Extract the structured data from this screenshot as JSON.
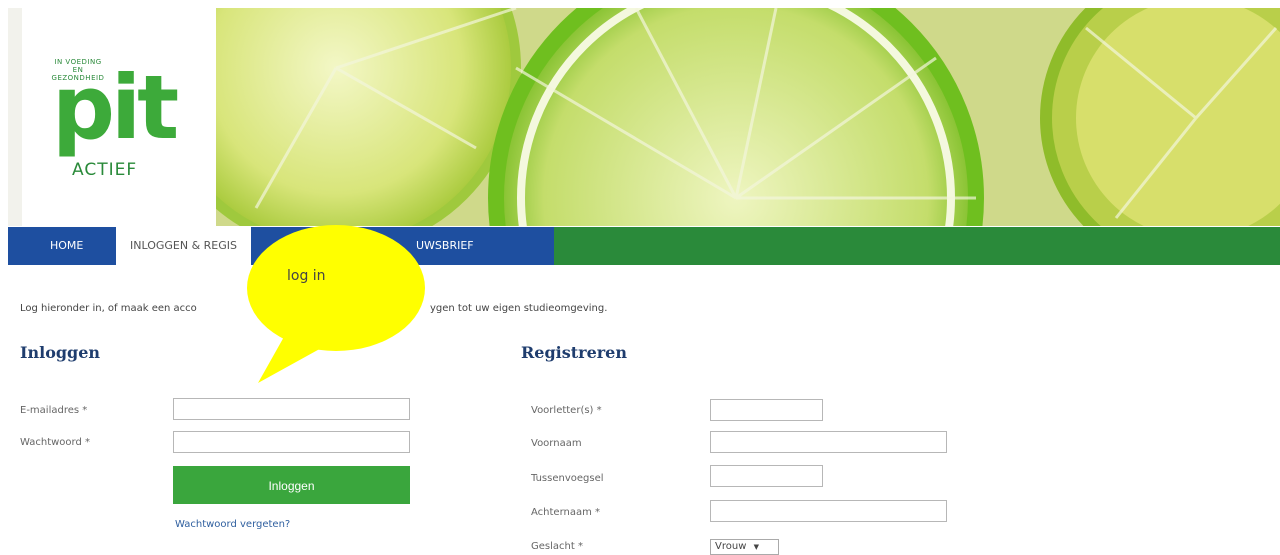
{
  "logo": {
    "tagline": "IN VOEDING EN GEZONDHEID",
    "pit": "pit",
    "actief": "ACTIEF"
  },
  "nav": {
    "items": [
      "HOME",
      "INLOGGEN & REGIS",
      "UWSBRIEF"
    ]
  },
  "intro": "Log hieronder in, of maak een acco",
  "intro_end": "ygen tot uw eigen studieomgeving.",
  "login": {
    "title": "Inloggen",
    "email_label": "E-mailadres *",
    "password_label": "Wachtwoord *",
    "email_value": "",
    "password_value": "",
    "submit": "Inloggen",
    "forgot": "Wachtwoord vergeten?"
  },
  "register": {
    "title": "Registreren",
    "fields": [
      "Voorletter(s) *",
      "Voornaam",
      "Tussenvoegsel",
      "Achternaam *",
      "Geslacht *"
    ],
    "gender_value": "Vrouw",
    "gender_caret": "▼"
  },
  "annotation": {
    "text": "log in",
    "color": "#ffff00"
  },
  "colors": {
    "nav_blue": "#1e4fa0",
    "nav_green": "#2a8a3a",
    "button_green": "#3aa63d",
    "title_blue": "#1f3d6e",
    "link_blue": "#2f5f9f"
  }
}
